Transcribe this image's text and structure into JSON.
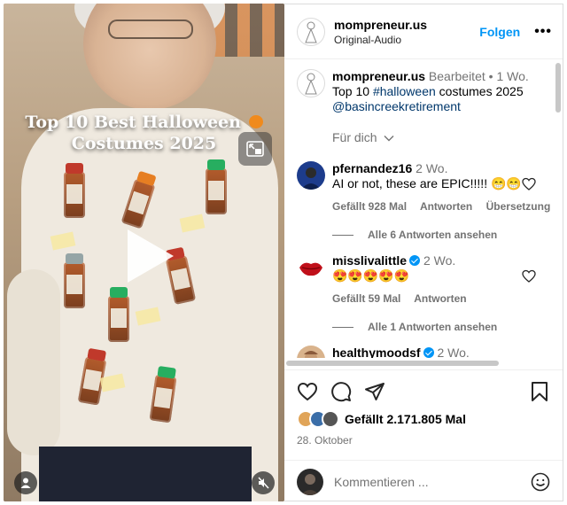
{
  "video": {
    "overlay_line1": "Top 10 Best Halloween",
    "overlay_line2": "Costumes 2025"
  },
  "header": {
    "username": "mompreneur.us",
    "audio": "Original-Audio",
    "follow_label": "Folgen",
    "more_label": "•••"
  },
  "caption": {
    "username": "mompreneur.us",
    "edited": "Bearbeitet",
    "separator": "•",
    "time": "1 Wo.",
    "text_before": "Top 10 ",
    "hashtag": "#halloween",
    "text_after": " costumes 2025",
    "mention": "@basincreekretirement",
    "translate": "Für dich"
  },
  "comments": [
    {
      "username": "pfernandez16",
      "time": "2 Wo.",
      "text": "AI or not, these are EPIC!!!!! 😁😁",
      "likes": "Gefällt 928 Mal",
      "reply": "Antworten",
      "translate": "Übersetzung ansehen",
      "replies": "Alle 6 Antworten ansehen",
      "avatar_color": "#1d3c8c"
    },
    {
      "username": "misslivalittle",
      "time": "2 Wo.",
      "text": "😍😍😍😍😍",
      "likes": "Gefällt 59 Mal",
      "reply": "Antworten",
      "replies": "Alle 1 Antworten ansehen",
      "avatar_color": "#c0101a"
    },
    {
      "username": "healthymoodsf",
      "time": "2 Wo.",
      "avatar_color": "#d9b38c"
    }
  ],
  "footer": {
    "likes": "Gefällt 2.171.805 Mal",
    "date": "28. Oktober",
    "comment_placeholder": "Kommentieren ..."
  },
  "colors": {
    "accent": "#0095f6",
    "link": "#00376b",
    "secondary_text": "#737373"
  }
}
